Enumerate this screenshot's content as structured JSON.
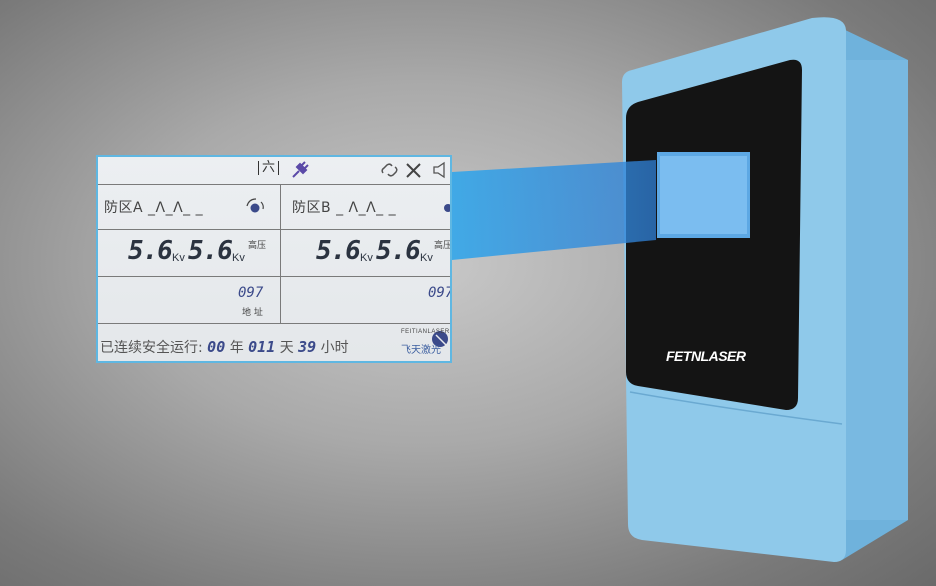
{
  "colors": {
    "device_blue": "#8fc9ea",
    "device_shade": "#6fb2dc",
    "panel_black": "#141414",
    "lcd_frame": "#5fb7e2",
    "digit_blue": "#3b4a8a"
  },
  "device": {
    "brand": "FETNLASER"
  },
  "lcd": {
    "mode_label": "六",
    "zone_a": {
      "label": "防区A",
      "pattern": "_Ʌ_Ʌ_ _",
      "voltage_1": "5.6",
      "voltage_2": "5.6",
      "unit_1": "Kv",
      "unit_2": "Kv",
      "hv_label": "高压",
      "address": "097",
      "address_label": "地 址"
    },
    "zone_b": {
      "label": "防区B",
      "pattern": "_ Ʌ_Ʌ_ _",
      "voltage_1": "5.6",
      "voltage_2": "5.6",
      "unit_1": "Kv",
      "unit_2": "Kv",
      "hv_label": "高压",
      "address": "097"
    },
    "runtime": {
      "prefix": "已连续安全运行:",
      "years": "00",
      "years_label": "年",
      "days": "011",
      "days_label": "天",
      "hours": "39",
      "hours_label": "小时"
    },
    "logo_en": "FEITIANLASER",
    "logo_cn": "飞天激光"
  }
}
